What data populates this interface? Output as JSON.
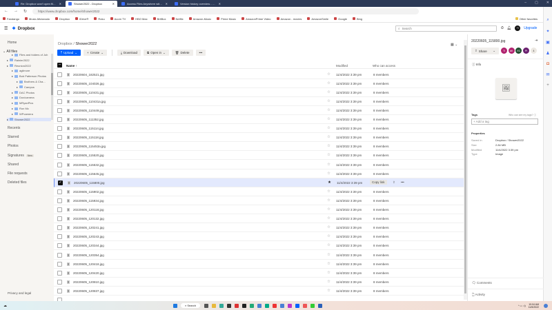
{
  "browser": {
    "tabs": [
      {
        "label": "Re: Dropbox won't open files - D"
      },
      {
        "label": "Shower2022 - Dropbox",
        "active": true
      },
      {
        "label": "Access Files Anywhere with 2 TB"
      },
      {
        "label": "Version history overview - Drop"
      }
    ],
    "url": "https://www.dropbox.com/home/Shower2022",
    "bookmarks": [
      "Fandango",
      "Music Aficionado",
      "Dropbox",
      "iDrive®",
      "Roku",
      "Acorn TV",
      "HBO Max",
      "BritBox",
      "Netflix",
      "Amazon-Music",
      "Prime Music",
      "AmazonPrime Video",
      "Amazon - movies",
      "AmazonSmile",
      "Google",
      "Bing"
    ],
    "other_favorites": "Other favorites"
  },
  "header": {
    "logo": "Dropbox",
    "search_placeholder": "Search",
    "avatar": "TI",
    "upgrade": "Upgrade"
  },
  "sidebar": {
    "home": "Home",
    "all_files": "All files",
    "tree": [
      {
        "label": "Files and folders of Joh",
        "indent": 2
      },
      {
        "label": "Rainier2022",
        "indent": 1
      },
      {
        "label": "Reunion2022",
        "indent": 1
      },
      {
        "label": "agilmore",
        "indent": 2
      },
      {
        "label": "Bob Patterson Photos",
        "indent": 2
      },
      {
        "label": "Brothers & Cha...",
        "indent": 3
      },
      {
        "label": "Campus",
        "indent": 3
      },
      {
        "label": "DAC Photos",
        "indent": 2
      },
      {
        "label": "Dox/camera",
        "indent": 2
      },
      {
        "label": "MRyanPics",
        "indent": 2
      },
      {
        "label": "Ron Mc",
        "indent": 2
      },
      {
        "label": "WPcamera",
        "indent": 2
      },
      {
        "label": "Shower2022",
        "indent": 1,
        "selected": true
      }
    ],
    "items": [
      "Recents",
      "Starred",
      "Photos",
      "Signatures",
      "Shared",
      "File requests",
      "Deleted files"
    ],
    "new_badge": "New",
    "footer": "Privacy and legal"
  },
  "main": {
    "breadcrumb_root": "Dropbox",
    "breadcrumb_sep": "/",
    "breadcrumb_current": "Shower2022",
    "toolbar": {
      "upload": "Upload",
      "create": "Create",
      "download": "Download",
      "open_in": "Open in",
      "delete": "Delete",
      "more": "•••"
    },
    "columns": {
      "name": "Name",
      "sort": "↑",
      "modified": "Modified",
      "access": "Who can access"
    },
    "copy_link": "Copy link",
    "files": [
      {
        "name": "20220604_182521.jpg",
        "modified": "11/4/2022 3:39 pm",
        "access": "8 members"
      },
      {
        "name": "20220605_104026.jpg",
        "modified": "11/4/2022 3:39 pm",
        "access": "8 members"
      },
      {
        "name": "20220605_110431.jpg",
        "modified": "11/4/2022 3:39 pm",
        "access": "8 members"
      },
      {
        "name": "20220605_110431a.jpg",
        "modified": "11/4/2022 3:39 pm",
        "access": "8 members"
      },
      {
        "name": "20220605_110449.jpg",
        "modified": "11/4/2022 3:39 pm",
        "access": "8 members"
      },
      {
        "name": "20220605_111352.jpg",
        "modified": "11/4/2022 3:39 pm",
        "access": "8 members"
      },
      {
        "name": "20220605_115114.jpg",
        "modified": "11/4/2022 3:39 pm",
        "access": "8 members"
      },
      {
        "name": "20220605_115118.jpg",
        "modified": "11/4/2022 3:39 pm",
        "access": "8 members"
      },
      {
        "name": "20220605_115453a.jpg",
        "modified": "11/4/2022 3:39 pm",
        "access": "8 members"
      },
      {
        "name": "20220605_115520.jpg",
        "modified": "11/4/2022 3:39 pm",
        "access": "8 members"
      },
      {
        "name": "20220605_115532.jpg",
        "modified": "11/4/2022 3:39 pm",
        "access": "8 members"
      },
      {
        "name": "20220605_115645.jpg",
        "modified": "11/4/2022 3:39 pm",
        "access": "8 members"
      },
      {
        "name": "20220605_115800.jpg",
        "modified": "11/4/2022 3:39 pm",
        "access": "",
        "selected": true
      },
      {
        "name": "20220605_115902.jpg",
        "modified": "11/4/2022 3:39 pm",
        "access": "8 members"
      },
      {
        "name": "20220605_115934.jpg",
        "modified": "11/4/2022 3:39 pm",
        "access": "8 members"
      },
      {
        "name": "20220605_120118.jpg",
        "modified": "11/4/2022 3:39 pm",
        "access": "8 members"
      },
      {
        "name": "20220605_120132.jpg",
        "modified": "11/4/2022 3:39 pm",
        "access": "8 members"
      },
      {
        "name": "20220605_120241.jpg",
        "modified": "11/4/2022 3:39 pm",
        "access": "8 members"
      },
      {
        "name": "20220605_120243.jpg",
        "modified": "11/4/2022 3:39 pm",
        "access": "8 members"
      },
      {
        "name": "20220605_120344.jpg",
        "modified": "11/4/2022 3:39 pm",
        "access": "8 members"
      },
      {
        "name": "20220605_120354.jpg",
        "modified": "11/4/2022 3:39 pm",
        "access": "8 members"
      },
      {
        "name": "20220605_120418.jpg",
        "modified": "11/4/2022 3:39 pm",
        "access": "8 members"
      },
      {
        "name": "20220605_120420.jpg",
        "modified": "11/4/2022 3:39 pm",
        "access": "8 members"
      },
      {
        "name": "20220605_120810.jpg",
        "modified": "11/4/2022 3:39 pm",
        "access": "8 members"
      },
      {
        "name": "20220605_120837.jpg",
        "modified": "11/4/2022 3:39 pm",
        "access": "8 members"
      }
    ]
  },
  "panel": {
    "filename": "20220605_115800.jpg",
    "share": "Share",
    "members": [
      {
        "initials": "TI",
        "color": "#b0226e"
      },
      {
        "initials": "AK",
        "color": "#b0226e"
      },
      {
        "initials": "EC",
        "color": "#1f4d2e"
      },
      {
        "initials": "PI",
        "color": "#6a1f6e"
      }
    ],
    "more_count": "4",
    "info": "Info",
    "tags": "Tags",
    "tags_help": "Who can see my tags?",
    "tag_placeholder": "+ Add a tag",
    "properties": "Properties",
    "props": [
      {
        "k": "Saved in",
        "v": "Dropbox / Shower2022"
      },
      {
        "k": "Size",
        "v": "2.84 MB"
      },
      {
        "k": "Modified",
        "v": "11/4/2022 3:39 pm"
      },
      {
        "k": "Type",
        "v": "Image"
      }
    ],
    "comments": "Comments",
    "activity": "Activity"
  },
  "taskbar": {
    "search": "Search",
    "time": "10:04 AM",
    "date": "11/5/2022"
  }
}
